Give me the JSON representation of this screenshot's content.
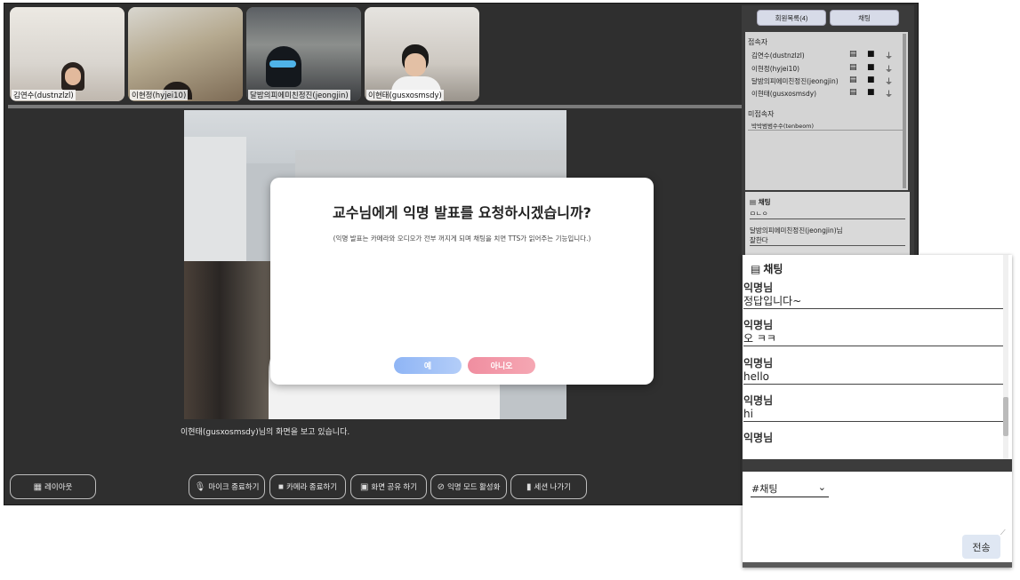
{
  "thumbnails": [
    {
      "label": "김연수(dustnzlzl)"
    },
    {
      "label": "이현정(hyjei10)"
    },
    {
      "label": "달밤의피에미친정진(jeongjin)"
    },
    {
      "label": "이현태(gusxosmsdy)"
    }
  ],
  "main": {
    "viewing_text": "이현태(gusxosmsdy)님의 화면을 보고 있습니다."
  },
  "modal": {
    "title": "교수님에게 익명 발표를 요청하시겠습니까?",
    "subtitle": "(익명 발표는 카메라와 오디오가 전부 꺼지게 되며 채팅을 치면 TTS가 읽어주는 기능입니다.)",
    "yes_label": "예",
    "no_label": "아니오"
  },
  "controls": {
    "layout_label": "레이아웃",
    "mic_label": "마이크 종료하기",
    "camera_label": "카메라 종료하기",
    "share_label": "화면 공유 하기",
    "anon_label": "익명 모드 활성화",
    "leave_label": "세션 나가기"
  },
  "side": {
    "tab_members": "회원목록(4)",
    "tab_chat": "채팅",
    "online_header": "접속자",
    "online_users": [
      {
        "name": "김연수(dustnzlzl)"
      },
      {
        "name": "이현정(hyjei10)"
      },
      {
        "name": "달밤의피에미친정진(jeongjin)"
      },
      {
        "name": "이현태(gusxosmsdy)"
      }
    ],
    "offline_header": "미접속자",
    "offline_users": [
      {
        "name": "박박범범수수(tenbeom)"
      }
    ],
    "chat_header": "채팅",
    "chat_first": "ㅁㄴㅇ",
    "chat_author2": "달밤의피에미친정진(jeongjin)님",
    "chat_text2": "잘한다"
  },
  "zoom_chat": {
    "header": "채팅",
    "messages": [
      {
        "author": "익명님",
        "text": "정답입니다~"
      },
      {
        "author": "익명님",
        "text": "오 ㅋㅋ"
      },
      {
        "author": "익명님",
        "text": "hello"
      },
      {
        "author": "익명님",
        "text": "hi"
      },
      {
        "author": "익명님",
        "text": ""
      }
    ],
    "channel": "#채팅",
    "send_label": "전송"
  },
  "icons": {
    "chat": "chat-icon",
    "video": "video-icon",
    "mic": "mic-icon"
  }
}
